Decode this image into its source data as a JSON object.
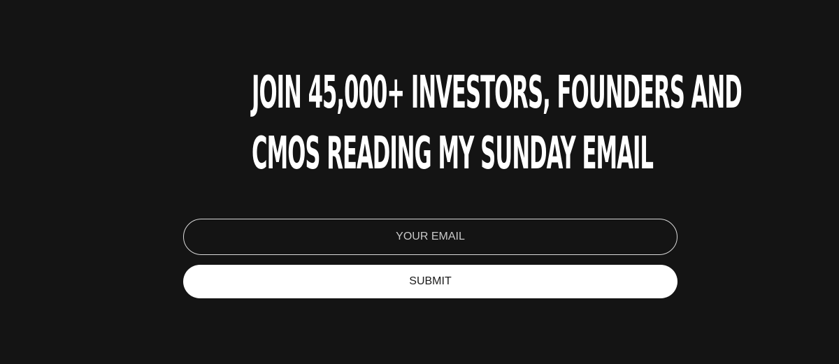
{
  "headline": {
    "line1": "JOIN 45,000+ INVESTORS, FOUNDERS AND",
    "line2": "CMOS READING MY SUNDAY EMAIL"
  },
  "form": {
    "email_placeholder": "YOUR EMAIL",
    "email_value": "",
    "submit_label": "SUBMIT"
  },
  "colors": {
    "background": "#141414",
    "text": "#ffffff",
    "button_background": "#ffffff",
    "button_text": "#1a1a1a"
  }
}
